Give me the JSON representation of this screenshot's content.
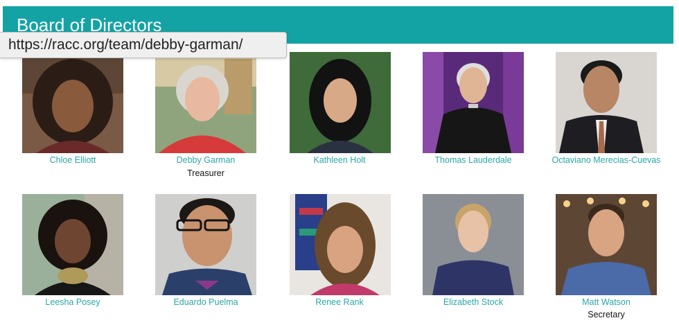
{
  "header": {
    "title": "Board of Directors"
  },
  "tooltip": {
    "url": "https://racc.org/team/debby-garman/"
  },
  "members": [
    {
      "name": "Chloe Elliott",
      "role": ""
    },
    {
      "name": "Debby Garman",
      "role": "Treasurer"
    },
    {
      "name": "Kathleen Holt",
      "role": ""
    },
    {
      "name": "Thomas Lauderdale",
      "role": ""
    },
    {
      "name": "Octaviano Merecias-Cuevas",
      "role": ""
    },
    {
      "name": "Leesha Posey",
      "role": ""
    },
    {
      "name": "Eduardo Puelma",
      "role": ""
    },
    {
      "name": "Renee Rank",
      "role": ""
    },
    {
      "name": "Elizabeth Stock",
      "role": ""
    },
    {
      "name": "Matt Watson",
      "role": "Secretary"
    }
  ],
  "colors": {
    "accent": "#14a3a4",
    "link": "#2aa7a8"
  }
}
